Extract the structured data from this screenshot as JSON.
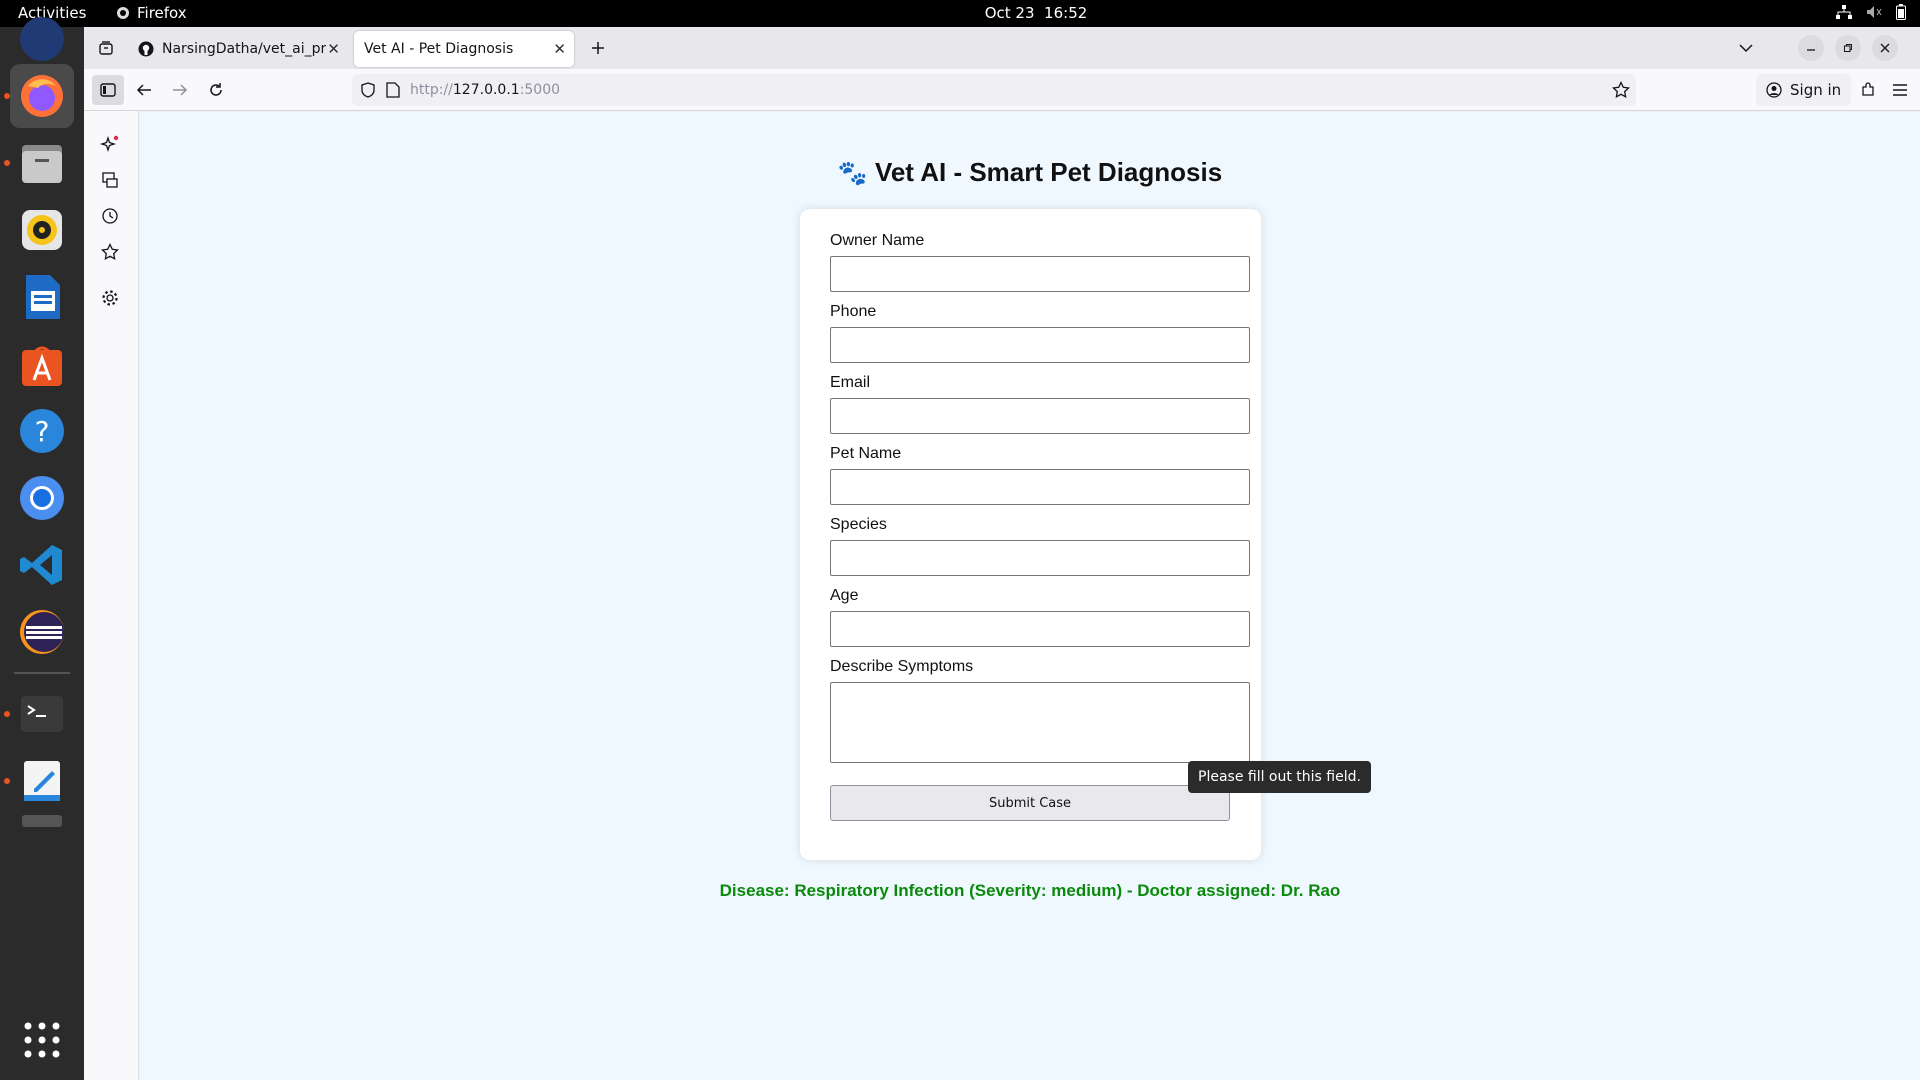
{
  "topbar": {
    "activities": "Activities",
    "app_name": "Firefox",
    "date": "Oct 23",
    "time": "16:52"
  },
  "dock": {
    "items": [
      "firefox-icon",
      "files-icon",
      "rhythmbox-icon",
      "writer-icon",
      "app-center-icon",
      "help-icon",
      "chromium-icon",
      "vscode-icon",
      "eclipse-icon",
      "terminal-icon",
      "text-editor-icon",
      "show-apps-icon"
    ]
  },
  "browser": {
    "tabs": [
      {
        "title": "NarsingDatha/vet_ai_pro",
        "active": false
      },
      {
        "title": "Vet AI - Pet Diagnosis",
        "active": true
      }
    ],
    "url_prefix": "http://",
    "url_host": "127.0.0.1",
    "url_port": ":5000",
    "signin_label": "Sign in"
  },
  "page": {
    "title": "Vet AI - Smart Pet Diagnosis",
    "fields": {
      "owner_name": "Owner Name",
      "phone": "Phone",
      "email": "Email",
      "pet_name": "Pet Name",
      "species": "Species",
      "age": "Age",
      "symptoms": "Describe Symptoms"
    },
    "submit_label": "Submit Case",
    "tooltip": "Please fill out this field.",
    "result": "Disease: Respiratory Infection (Severity: medium) - Doctor assigned: Dr. Rao"
  },
  "colors": {
    "page_bg": "#f0f8ff",
    "result_text": "#0a8a0a",
    "dock_indicator": "#e95420"
  }
}
